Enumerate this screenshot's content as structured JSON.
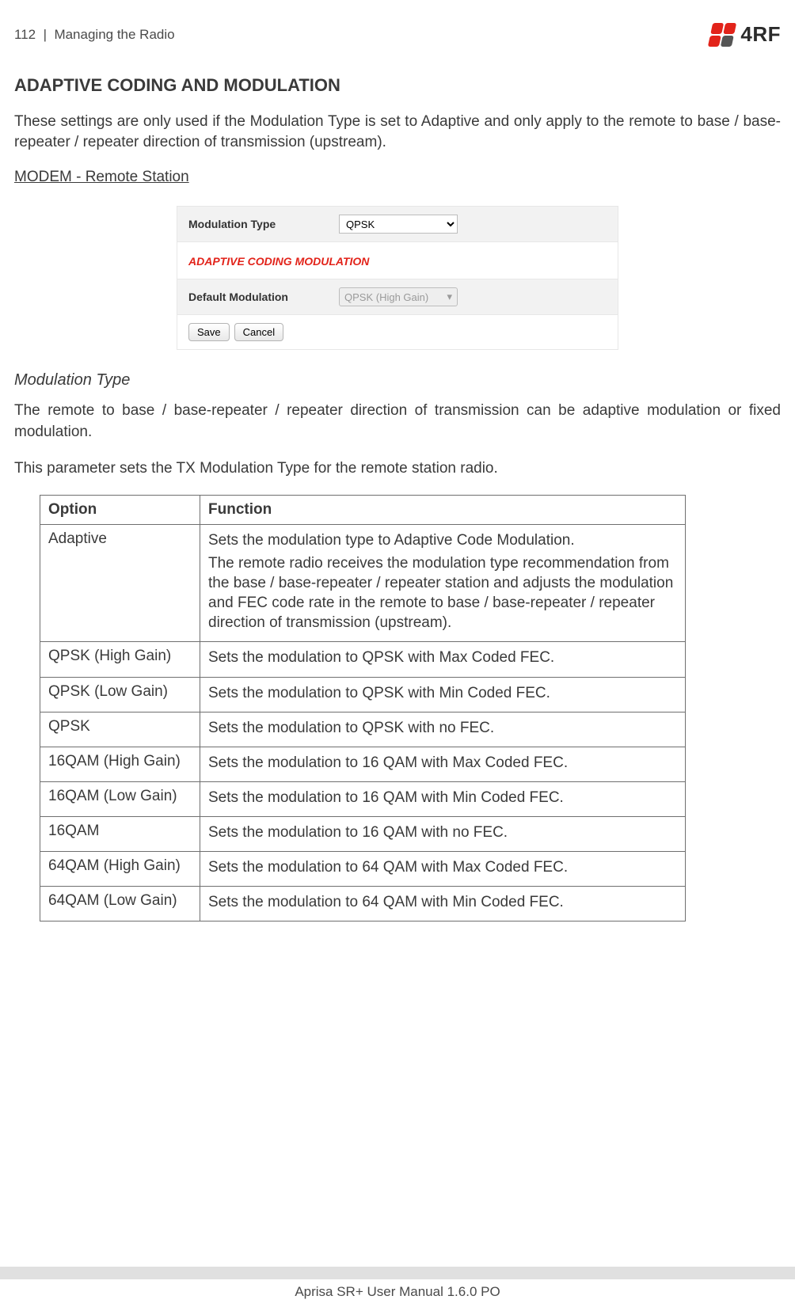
{
  "header": {
    "page_num": "112",
    "separator": "|",
    "title": "Managing the Radio",
    "logo_text": "4RF"
  },
  "section_title": "ADAPTIVE CODING AND MODULATION",
  "intro_para": "These settings are only used if the Modulation Type is set to Adaptive and only apply to the remote to base / base-repeater / repeater direction of transmission (upstream).",
  "subhead": "MODEM - Remote Station",
  "panel": {
    "mod_type_label": "Modulation Type",
    "mod_type_value": "QPSK",
    "red_title": "ADAPTIVE CODING MODULATION",
    "default_mod_label": "Default Modulation",
    "default_mod_value": "QPSK (High Gain)",
    "save": "Save",
    "cancel": "Cancel"
  },
  "mod_type_section": {
    "heading": "Modulation Type",
    "para1": "The remote to base / base-repeater / repeater direction of transmission can be adaptive modulation or fixed modulation.",
    "para2": "This parameter sets the TX Modulation Type for the remote station radio."
  },
  "table": {
    "headers": {
      "option": "Option",
      "function": "Function"
    },
    "rows": [
      {
        "option": "Adaptive",
        "function_lines": [
          "Sets the modulation type to Adaptive Code Modulation.",
          "The remote radio receives the modulation type recommendation from the base / base-repeater / repeater station and adjusts the modulation and FEC code rate in the remote to base / base-repeater / repeater direction of transmission (upstream)."
        ]
      },
      {
        "option": "QPSK (High Gain)",
        "function_lines": [
          "Sets the modulation to QPSK with Max Coded FEC."
        ]
      },
      {
        "option": "QPSK (Low Gain)",
        "function_lines": [
          "Sets the modulation to QPSK with Min Coded FEC."
        ]
      },
      {
        "option": "QPSK",
        "function_lines": [
          "Sets the modulation to QPSK with no FEC."
        ]
      },
      {
        "option": "16QAM (High Gain)",
        "function_lines": [
          "Sets the modulation to 16 QAM with Max Coded FEC."
        ]
      },
      {
        "option": "16QAM (Low Gain)",
        "function_lines": [
          "Sets the modulation to 16 QAM with Min Coded FEC."
        ]
      },
      {
        "option": "16QAM",
        "function_lines": [
          "Sets the modulation to 16 QAM with no FEC."
        ]
      },
      {
        "option": "64QAM (High Gain)",
        "function_lines": [
          "Sets the modulation to 64 QAM with Max Coded FEC."
        ]
      },
      {
        "option": "64QAM (Low Gain)",
        "function_lines": [
          "Sets the modulation to 64 QAM with Min Coded FEC."
        ]
      }
    ]
  },
  "footer": "Aprisa SR+ User Manual 1.6.0 PO"
}
